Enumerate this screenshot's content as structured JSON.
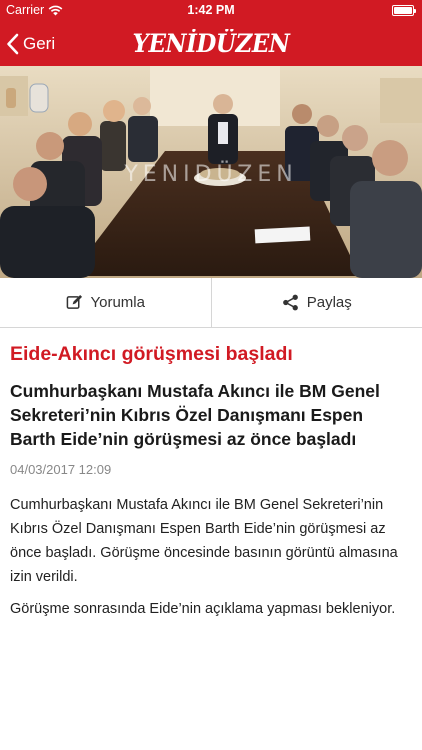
{
  "status_bar": {
    "carrier": "Carrier",
    "time": "1:42 PM",
    "wifi_icon": "wifi-icon",
    "battery_icon": "battery-icon",
    "battery_level": 1.0
  },
  "nav": {
    "back_label": "Geri",
    "back_icon": "chevron-left-icon",
    "logo_text": "YENİDÜZEN",
    "background_color": "#d11a23"
  },
  "photo": {
    "watermark": "YENIDÜZEN"
  },
  "actions": {
    "comment_label": "Yorumla",
    "comment_icon": "edit-icon",
    "share_label": "Paylaş",
    "share_icon": "share-icon"
  },
  "article": {
    "headline": "Eide-Akıncı görüşmesi başladı",
    "subheadline": "Cumhurbaşkanı Mustafa Akıncı ile BM Genel Sekreteri’nin Kıbrıs Özel Danışmanı Espen Barth Eide’nin görüşmesi az önce başladı",
    "date": "04/03/2017 12:09",
    "paragraphs": [
      "Cumhurbaşkanı Mustafa Akıncı ile BM Genel Sekreteri’nin Kıbrıs Özel Danışmanı Espen Barth Eide’nin görüşmesi az önce başladı. Görüşme öncesinde basının görüntü almasına izin verildi.",
      "Görüşme sonrasında Eide’nin açıklama yapması bekleniyor."
    ],
    "headline_color": "#d11a23"
  }
}
